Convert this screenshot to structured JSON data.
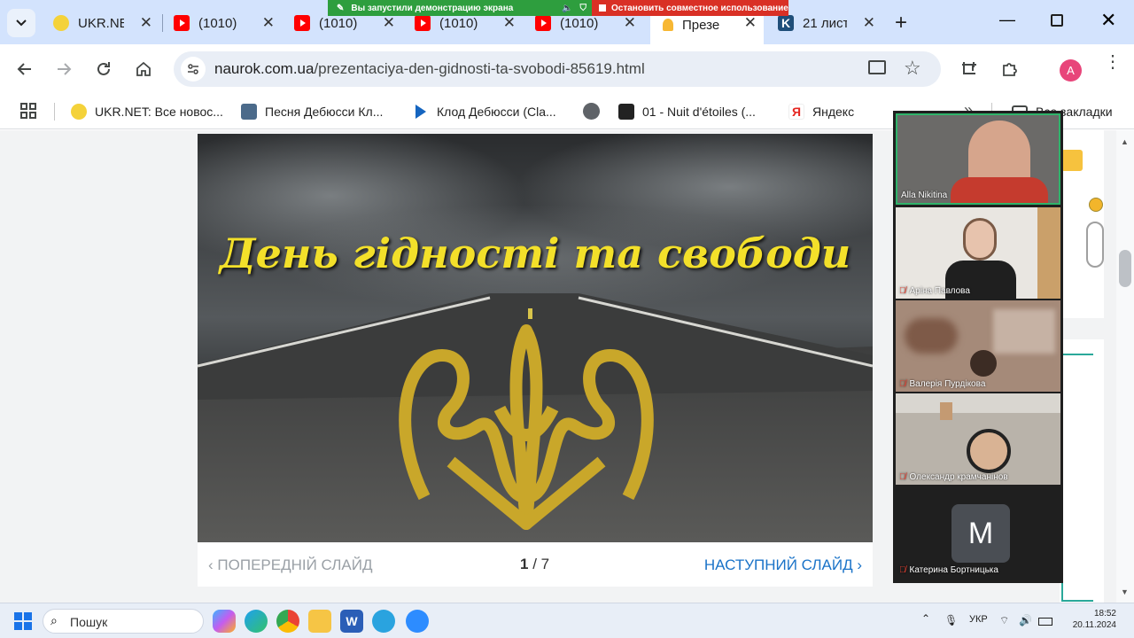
{
  "browser": {
    "tabs": [
      {
        "title": "UKR.NE",
        "icon": "ukrnet-icon"
      },
      {
        "title": "(1010)",
        "icon": "youtube-icon"
      },
      {
        "title": "(1010)",
        "icon": "youtube-icon"
      },
      {
        "title": "(1010)",
        "icon": "youtube-icon"
      },
      {
        "title": "(1010)",
        "icon": "youtube-icon"
      },
      {
        "title": "Презе",
        "icon": "naurok-icon",
        "active": true
      },
      {
        "title": "21 лист",
        "icon": "k-icon"
      }
    ],
    "share_banner": {
      "status": "Вы запустили демонстрацию экрана",
      "stop": "Остановить совместное использование"
    },
    "url_host": "naurok.com.ua",
    "url_path": "/prezentaciya-den-gidnosti-ta-svobodi-85619.html",
    "profile_initial": "A",
    "bookmarks": [
      {
        "label": "UKR.NET: Все новос...",
        "icon": "ukrnet-icon"
      },
      {
        "label": "Песня Дебюсси Кл...",
        "icon": "bookmark-site-icon"
      },
      {
        "label": "Клод Дебюсси (Cla...",
        "icon": "play-icon"
      },
      {
        "label": "01 - Nuit d'étoiles (...",
        "icon": "play-square-icon"
      },
      {
        "label": "Яндекс",
        "icon": "yandex-icon"
      }
    ],
    "all_bookmarks": "Все закладки"
  },
  "slide": {
    "title": "День гідності та свободи",
    "prev_label": "ПОПЕРЕДНІЙ СЛАЙД",
    "next_label": "НАСТУПНИЙ СЛАЙД",
    "current": "1",
    "total": "/ 7"
  },
  "participants": [
    {
      "name": "Alla Nikitina",
      "muted": false
    },
    {
      "name": "Аріна Павлова",
      "muted": true
    },
    {
      "name": "Валерія Пурдікова",
      "muted": true
    },
    {
      "name": "Олександр крамчанінов",
      "muted": true
    },
    {
      "name": "Катерина Бортницька",
      "muted": true,
      "initial": "M"
    }
  ],
  "taskbar": {
    "search": "Пошук",
    "lang": "УКР",
    "time": "18:52",
    "date": "20.11.2024"
  },
  "colors": {
    "tabstrip": "#d3e3fd",
    "slide_title": "#f3e02a",
    "next_link": "#1a73c8",
    "share_green": "#2e9e3e",
    "share_red": "#d93025"
  }
}
